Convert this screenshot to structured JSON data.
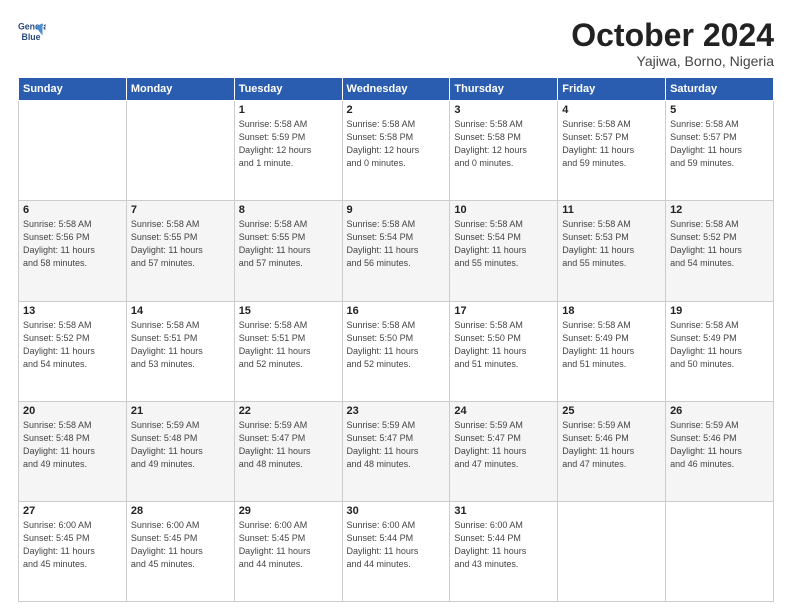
{
  "header": {
    "logo_line1": "General",
    "logo_line2": "Blue",
    "month": "October 2024",
    "location": "Yajiwa, Borno, Nigeria"
  },
  "weekdays": [
    "Sunday",
    "Monday",
    "Tuesday",
    "Wednesday",
    "Thursday",
    "Friday",
    "Saturday"
  ],
  "weeks": [
    [
      {
        "day": "",
        "info": ""
      },
      {
        "day": "",
        "info": ""
      },
      {
        "day": "1",
        "info": "Sunrise: 5:58 AM\nSunset: 5:59 PM\nDaylight: 12 hours\nand 1 minute."
      },
      {
        "day": "2",
        "info": "Sunrise: 5:58 AM\nSunset: 5:58 PM\nDaylight: 12 hours\nand 0 minutes."
      },
      {
        "day": "3",
        "info": "Sunrise: 5:58 AM\nSunset: 5:58 PM\nDaylight: 12 hours\nand 0 minutes."
      },
      {
        "day": "4",
        "info": "Sunrise: 5:58 AM\nSunset: 5:57 PM\nDaylight: 11 hours\nand 59 minutes."
      },
      {
        "day": "5",
        "info": "Sunrise: 5:58 AM\nSunset: 5:57 PM\nDaylight: 11 hours\nand 59 minutes."
      }
    ],
    [
      {
        "day": "6",
        "info": "Sunrise: 5:58 AM\nSunset: 5:56 PM\nDaylight: 11 hours\nand 58 minutes."
      },
      {
        "day": "7",
        "info": "Sunrise: 5:58 AM\nSunset: 5:55 PM\nDaylight: 11 hours\nand 57 minutes."
      },
      {
        "day": "8",
        "info": "Sunrise: 5:58 AM\nSunset: 5:55 PM\nDaylight: 11 hours\nand 57 minutes."
      },
      {
        "day": "9",
        "info": "Sunrise: 5:58 AM\nSunset: 5:54 PM\nDaylight: 11 hours\nand 56 minutes."
      },
      {
        "day": "10",
        "info": "Sunrise: 5:58 AM\nSunset: 5:54 PM\nDaylight: 11 hours\nand 55 minutes."
      },
      {
        "day": "11",
        "info": "Sunrise: 5:58 AM\nSunset: 5:53 PM\nDaylight: 11 hours\nand 55 minutes."
      },
      {
        "day": "12",
        "info": "Sunrise: 5:58 AM\nSunset: 5:52 PM\nDaylight: 11 hours\nand 54 minutes."
      }
    ],
    [
      {
        "day": "13",
        "info": "Sunrise: 5:58 AM\nSunset: 5:52 PM\nDaylight: 11 hours\nand 54 minutes."
      },
      {
        "day": "14",
        "info": "Sunrise: 5:58 AM\nSunset: 5:51 PM\nDaylight: 11 hours\nand 53 minutes."
      },
      {
        "day": "15",
        "info": "Sunrise: 5:58 AM\nSunset: 5:51 PM\nDaylight: 11 hours\nand 52 minutes."
      },
      {
        "day": "16",
        "info": "Sunrise: 5:58 AM\nSunset: 5:50 PM\nDaylight: 11 hours\nand 52 minutes."
      },
      {
        "day": "17",
        "info": "Sunrise: 5:58 AM\nSunset: 5:50 PM\nDaylight: 11 hours\nand 51 minutes."
      },
      {
        "day": "18",
        "info": "Sunrise: 5:58 AM\nSunset: 5:49 PM\nDaylight: 11 hours\nand 51 minutes."
      },
      {
        "day": "19",
        "info": "Sunrise: 5:58 AM\nSunset: 5:49 PM\nDaylight: 11 hours\nand 50 minutes."
      }
    ],
    [
      {
        "day": "20",
        "info": "Sunrise: 5:58 AM\nSunset: 5:48 PM\nDaylight: 11 hours\nand 49 minutes."
      },
      {
        "day": "21",
        "info": "Sunrise: 5:59 AM\nSunset: 5:48 PM\nDaylight: 11 hours\nand 49 minutes."
      },
      {
        "day": "22",
        "info": "Sunrise: 5:59 AM\nSunset: 5:47 PM\nDaylight: 11 hours\nand 48 minutes."
      },
      {
        "day": "23",
        "info": "Sunrise: 5:59 AM\nSunset: 5:47 PM\nDaylight: 11 hours\nand 48 minutes."
      },
      {
        "day": "24",
        "info": "Sunrise: 5:59 AM\nSunset: 5:47 PM\nDaylight: 11 hours\nand 47 minutes."
      },
      {
        "day": "25",
        "info": "Sunrise: 5:59 AM\nSunset: 5:46 PM\nDaylight: 11 hours\nand 47 minutes."
      },
      {
        "day": "26",
        "info": "Sunrise: 5:59 AM\nSunset: 5:46 PM\nDaylight: 11 hours\nand 46 minutes."
      }
    ],
    [
      {
        "day": "27",
        "info": "Sunrise: 6:00 AM\nSunset: 5:45 PM\nDaylight: 11 hours\nand 45 minutes."
      },
      {
        "day": "28",
        "info": "Sunrise: 6:00 AM\nSunset: 5:45 PM\nDaylight: 11 hours\nand 45 minutes."
      },
      {
        "day": "29",
        "info": "Sunrise: 6:00 AM\nSunset: 5:45 PM\nDaylight: 11 hours\nand 44 minutes."
      },
      {
        "day": "30",
        "info": "Sunrise: 6:00 AM\nSunset: 5:44 PM\nDaylight: 11 hours\nand 44 minutes."
      },
      {
        "day": "31",
        "info": "Sunrise: 6:00 AM\nSunset: 5:44 PM\nDaylight: 11 hours\nand 43 minutes."
      },
      {
        "day": "",
        "info": ""
      },
      {
        "day": "",
        "info": ""
      }
    ]
  ]
}
